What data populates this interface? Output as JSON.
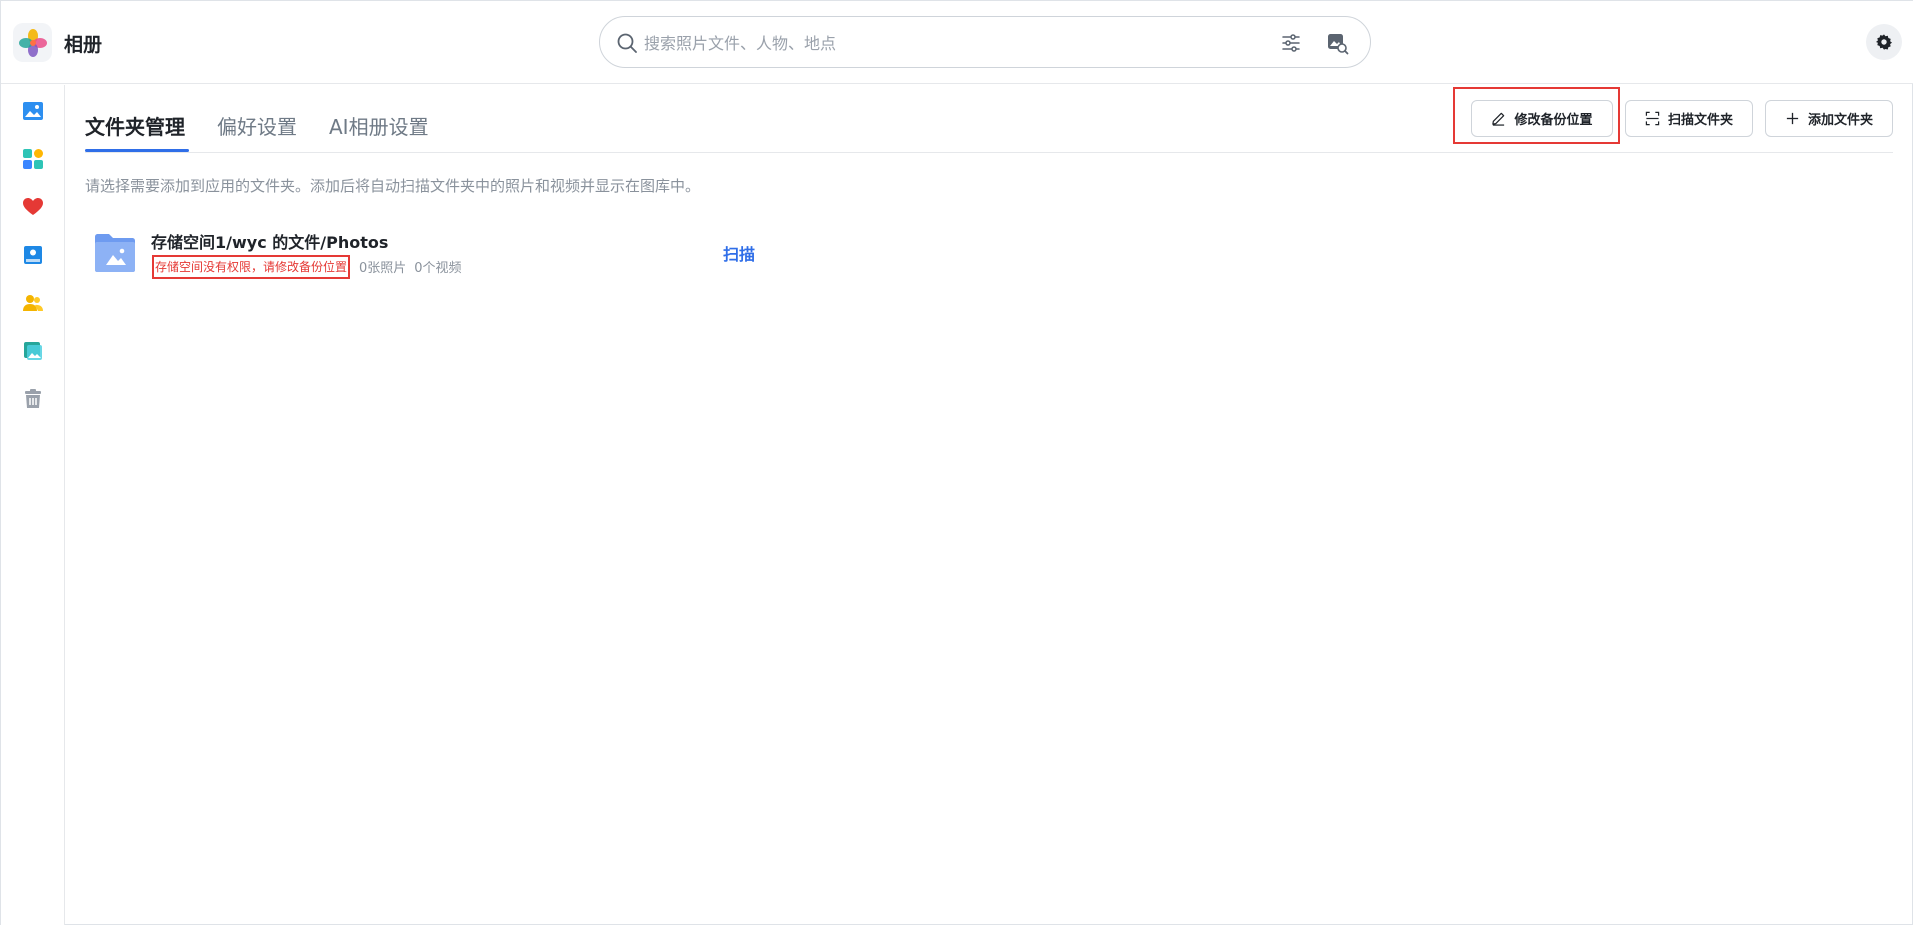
{
  "app": {
    "title": "相册"
  },
  "search": {
    "placeholder": "搜索照片文件、人物、地点"
  },
  "sidebar": {
    "items": [
      {
        "name": "photos",
        "icon": "image-icon"
      },
      {
        "name": "albums",
        "icon": "grid-icon"
      },
      {
        "name": "favorites",
        "icon": "heart-icon"
      },
      {
        "name": "memories",
        "icon": "photo-book-icon"
      },
      {
        "name": "people",
        "icon": "people-icon"
      },
      {
        "name": "shared",
        "icon": "shared-album-icon"
      },
      {
        "name": "trash",
        "icon": "trash-icon"
      }
    ]
  },
  "tabs": [
    {
      "label": "文件夹管理",
      "active": true
    },
    {
      "label": "偏好设置",
      "active": false
    },
    {
      "label": "AI相册设置",
      "active": false
    }
  ],
  "actions": {
    "change_backup": "修改备份位置",
    "scan_folder": "扫描文件夹",
    "add_folder": "添加文件夹"
  },
  "intro": "请选择需要添加到应用的文件夹。添加后将自动扫描文件夹中的照片和视频并显示在图库中。",
  "folders": [
    {
      "path": "存储空间1/wyc 的文件/Photos",
      "error": "存储空间没有权限，请修改备份位置",
      "photos": "0张照片",
      "videos": "0个视频",
      "scan_label": "扫描"
    }
  ],
  "colors": {
    "accent": "#2f6ee8",
    "error": "#e53935",
    "folder": "#6e9bf0"
  }
}
